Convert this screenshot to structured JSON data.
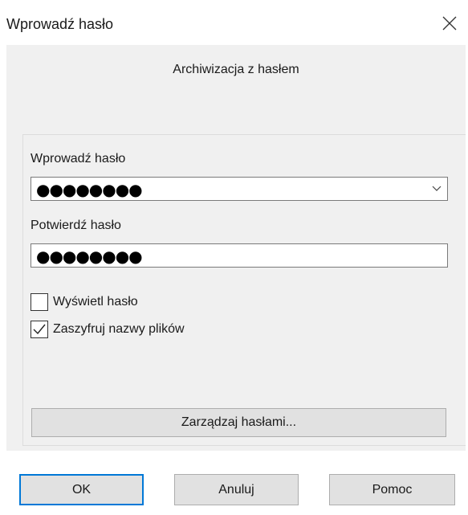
{
  "window": {
    "title": "Wprowadź hasło",
    "close_icon": "close-icon"
  },
  "panel": {
    "subtitle": "Archiwizacja z hasłem"
  },
  "password": {
    "label": "Wprowadź hasło",
    "masked_value": "●●●●●●●●",
    "dropdown_icon": "chevron-down-icon"
  },
  "confirm": {
    "label": "Potwierdź hasło",
    "masked_value": "●●●●●●●●"
  },
  "options": {
    "show_password": {
      "label": "Wyświetl hasło",
      "checked": false
    },
    "encrypt_names": {
      "label": "Zaszyfruj nazwy plików",
      "checked": true
    }
  },
  "manage_button": "Zarządzaj hasłami...",
  "buttons": {
    "ok": "OK",
    "cancel": "Anuluj",
    "help": "Pomoc"
  },
  "colors": {
    "accent": "#0078d7",
    "panel_bg": "#f0f0f0",
    "button_bg": "#e1e1e1"
  }
}
